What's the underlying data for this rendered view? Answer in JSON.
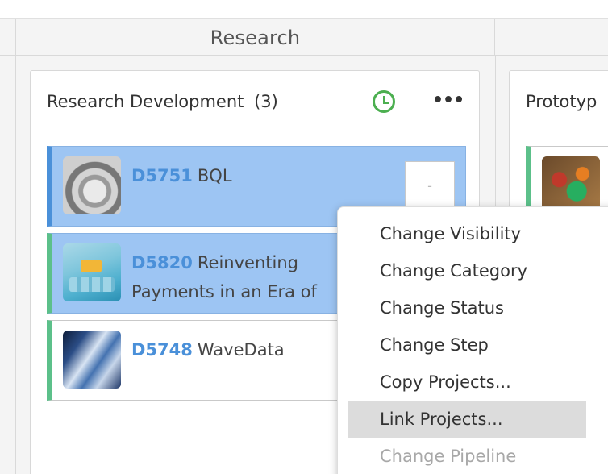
{
  "columns": {
    "research": {
      "title": "Research"
    }
  },
  "lane": {
    "title": "Research Development",
    "count": "(3)"
  },
  "right_lane": {
    "title": "Prototyp"
  },
  "projects": [
    {
      "id": "D5751",
      "name": "BQL",
      "thumb": "hard-drive",
      "selected": true,
      "mini_label": "-"
    },
    {
      "id": "D5820",
      "name": "Reinventing Payments in an Era of",
      "thumb": "hexagons",
      "selected": true
    },
    {
      "id": "D5748",
      "name": "WaveData",
      "thumb": "waves",
      "selected": false
    }
  ],
  "context_menu": {
    "items": [
      {
        "label": "Change Visibility",
        "state": "normal"
      },
      {
        "label": "Change Category",
        "state": "normal"
      },
      {
        "label": "Change Status",
        "state": "normal"
      },
      {
        "label": "Change Step",
        "state": "normal"
      },
      {
        "label": "Copy Projects...",
        "state": "normal"
      },
      {
        "label": "Link Projects...",
        "state": "hover"
      },
      {
        "label": "Change Pipeline",
        "state": "disabled"
      }
    ]
  },
  "icons": {
    "clock": "clock-icon",
    "more": "more-icon"
  },
  "colors": {
    "selected_card": "#9dc5f3",
    "accent_blue": "#4a90d9",
    "accent_green": "#5cc08a",
    "clock_green": "#4caf50"
  }
}
